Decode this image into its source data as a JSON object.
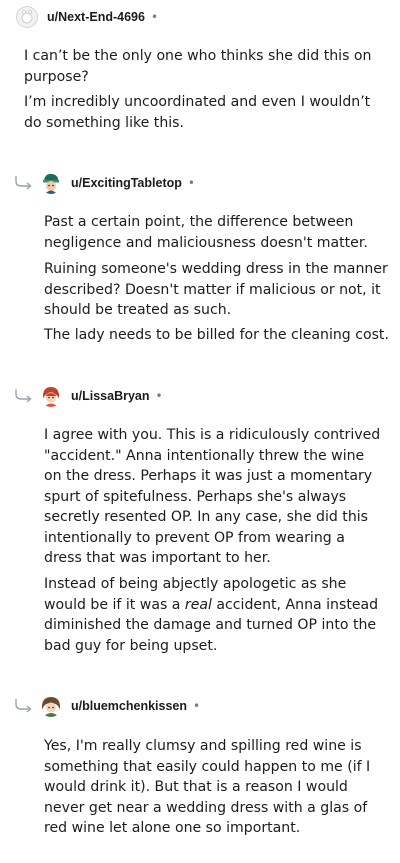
{
  "comments": [
    {
      "username": "u/Next-End-4696",
      "separator": "•",
      "avatar": "default-avatar-icon",
      "paragraphs": [
        "I can’t be the only one who thinks she did this on purpose?",
        "I’m incredibly uncoordinated and even I wouldn’t do something like this."
      ]
    },
    {
      "username": "u/ExcitingTabletop",
      "separator": "•",
      "avatar": "green-hat-avatar-icon",
      "paragraphs": [
        "Past a certain point, the difference between negligence and maliciousness doesn't matter.",
        "Ruining someone's wedding dress in the manner described? Doesn't matter if malicious or not, it should be treated as such.",
        "The lady needs to be billed for the cleaning cost."
      ]
    },
    {
      "username": "u/LissaBryan",
      "separator": "•",
      "avatar": "red-hair-avatar-icon",
      "paragraphs": [
        "I agree with you. This is a ridiculously contrived \"accident.\" Anna intentionally threw the wine on the dress. Perhaps it was just a momentary spurt of spitefulness. Perhaps she's always secretly resented OP. In any case, she did this intentionally to prevent OP from wearing a dress that was important to her."
      ],
      "para2": {
        "before": "Instead of being abjectly apologetic as she would be if it was a ",
        "emphasis": "real",
        "after": " accident, Anna instead diminished the damage and turned OP into the bad guy for being upset."
      }
    },
    {
      "username": "u/bluemchenkissen",
      "separator": "•",
      "avatar": "brown-hair-avatar-icon",
      "paragraphs": [
        "Yes, I'm really clumsy and spilling red wine is something that easily could happen to me (if I would drink it). But that is a reason I would never get near a wedding dress with a glas of red wine let alone one so important."
      ]
    }
  ]
}
